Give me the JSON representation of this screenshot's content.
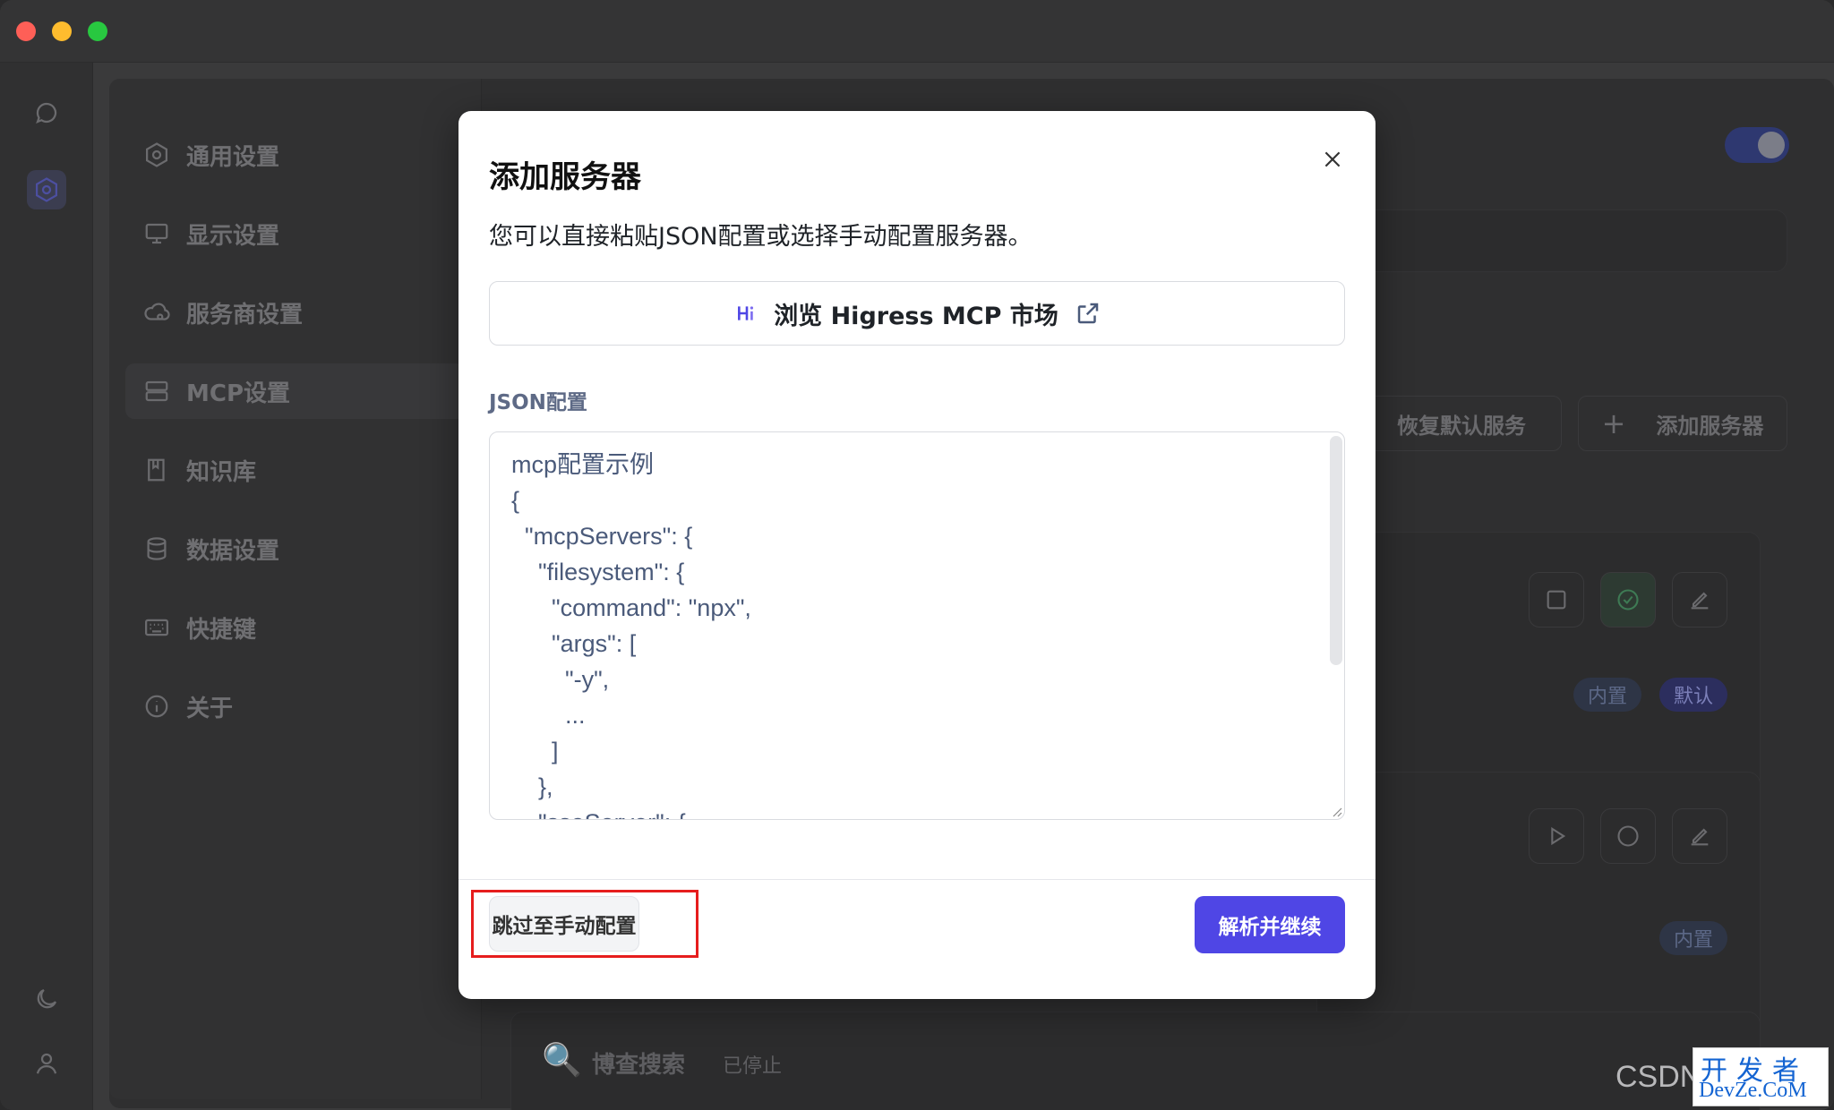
{
  "sidebar": {
    "items": [
      {
        "label": "通用设置",
        "icon": "gear-icon"
      },
      {
        "label": "显示设置",
        "icon": "monitor-icon"
      },
      {
        "label": "服务商设置",
        "icon": "cloud-icon"
      },
      {
        "label": "MCP设置",
        "icon": "server-icon"
      },
      {
        "label": "知识库",
        "icon": "book-icon"
      },
      {
        "label": "数据设置",
        "icon": "database-icon"
      },
      {
        "label": "快捷键",
        "icon": "keyboard-icon"
      },
      {
        "label": "关于",
        "icon": "info-icon"
      }
    ]
  },
  "background": {
    "restore_label": "恢复默认服务",
    "add_server_label": "添加服务器",
    "badge_builtin": "内置",
    "badge_default": "默认",
    "badge_builtin_2": "内置",
    "search_server_name": "博查搜索",
    "search_server_status": "已停止"
  },
  "modal": {
    "title": "添加服务器",
    "description": "您可以直接粘贴JSON配置或选择手动配置服务器。",
    "market_button": "浏览 Higress MCP 市场",
    "json_label": "JSON配置",
    "json_placeholder": "mcp配置示例\n{\n  \"mcpServers\": {\n    \"filesystem\": {\n      \"command\": \"npx\",\n      \"args\": [\n        \"-y\",\n        ...\n      ]\n    },\n    \"sseServer\": {",
    "skip_button": "跳过至手动配置",
    "parse_button": "解析并继续"
  },
  "colors": {
    "accent": "#4f46e5",
    "highlight_border": "#e61d1d"
  },
  "watermark": {
    "csdn": "CSDN",
    "top": "开发者",
    "bottom": "DevZe.CoM"
  }
}
